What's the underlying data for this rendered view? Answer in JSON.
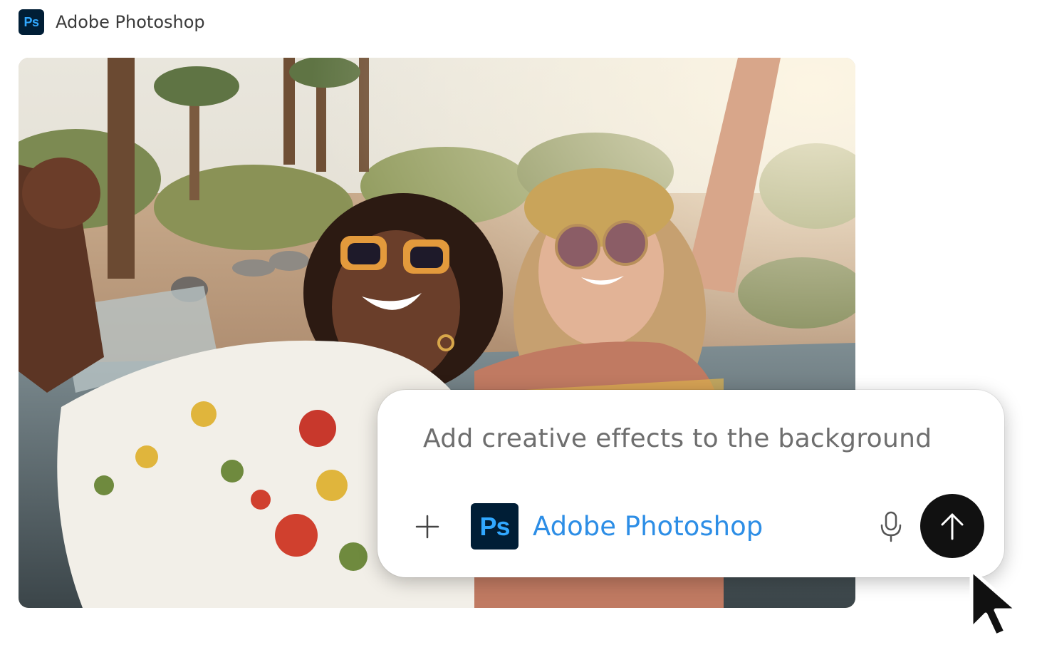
{
  "header": {
    "app_icon": "ps-icon",
    "app_icon_text": "Ps",
    "title": "Adobe Photoshop"
  },
  "photo": {
    "content": "photo"
  },
  "prompt": {
    "text": "Add creative effects to the background",
    "add_icon": "plus-icon",
    "app_chip": {
      "icon": "ps-icon",
      "icon_text": "Ps",
      "label": "Adobe Photoshop"
    },
    "mic_icon": "microphone-icon",
    "send_icon": "arrow-up-icon"
  },
  "cursor": "pointer-cursor-icon",
  "colors": {
    "ps_dark": "#001e36",
    "ps_blue": "#31a8ff",
    "chip_label": "#2d8ee6",
    "send_bg": "#111111"
  }
}
